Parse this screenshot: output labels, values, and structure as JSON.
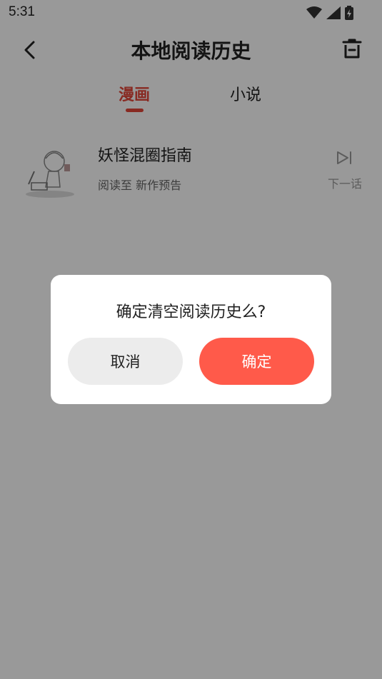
{
  "status": {
    "time": "5:31"
  },
  "header": {
    "title": "本地阅读历史"
  },
  "tabs": [
    {
      "label": "漫画",
      "active": true
    },
    {
      "label": "小说",
      "active": false
    }
  ],
  "history": [
    {
      "title": "妖怪混圈指南",
      "progress": "阅读至 新作预告",
      "next_label": "下一话"
    }
  ],
  "dialog": {
    "message": "确定清空阅读历史么?",
    "cancel_label": "取消",
    "confirm_label": "确定"
  },
  "colors": {
    "accent": "#e3473a",
    "confirm_button": "#ff5a4a",
    "overlay": "rgba(0,0,0,0.40)"
  }
}
